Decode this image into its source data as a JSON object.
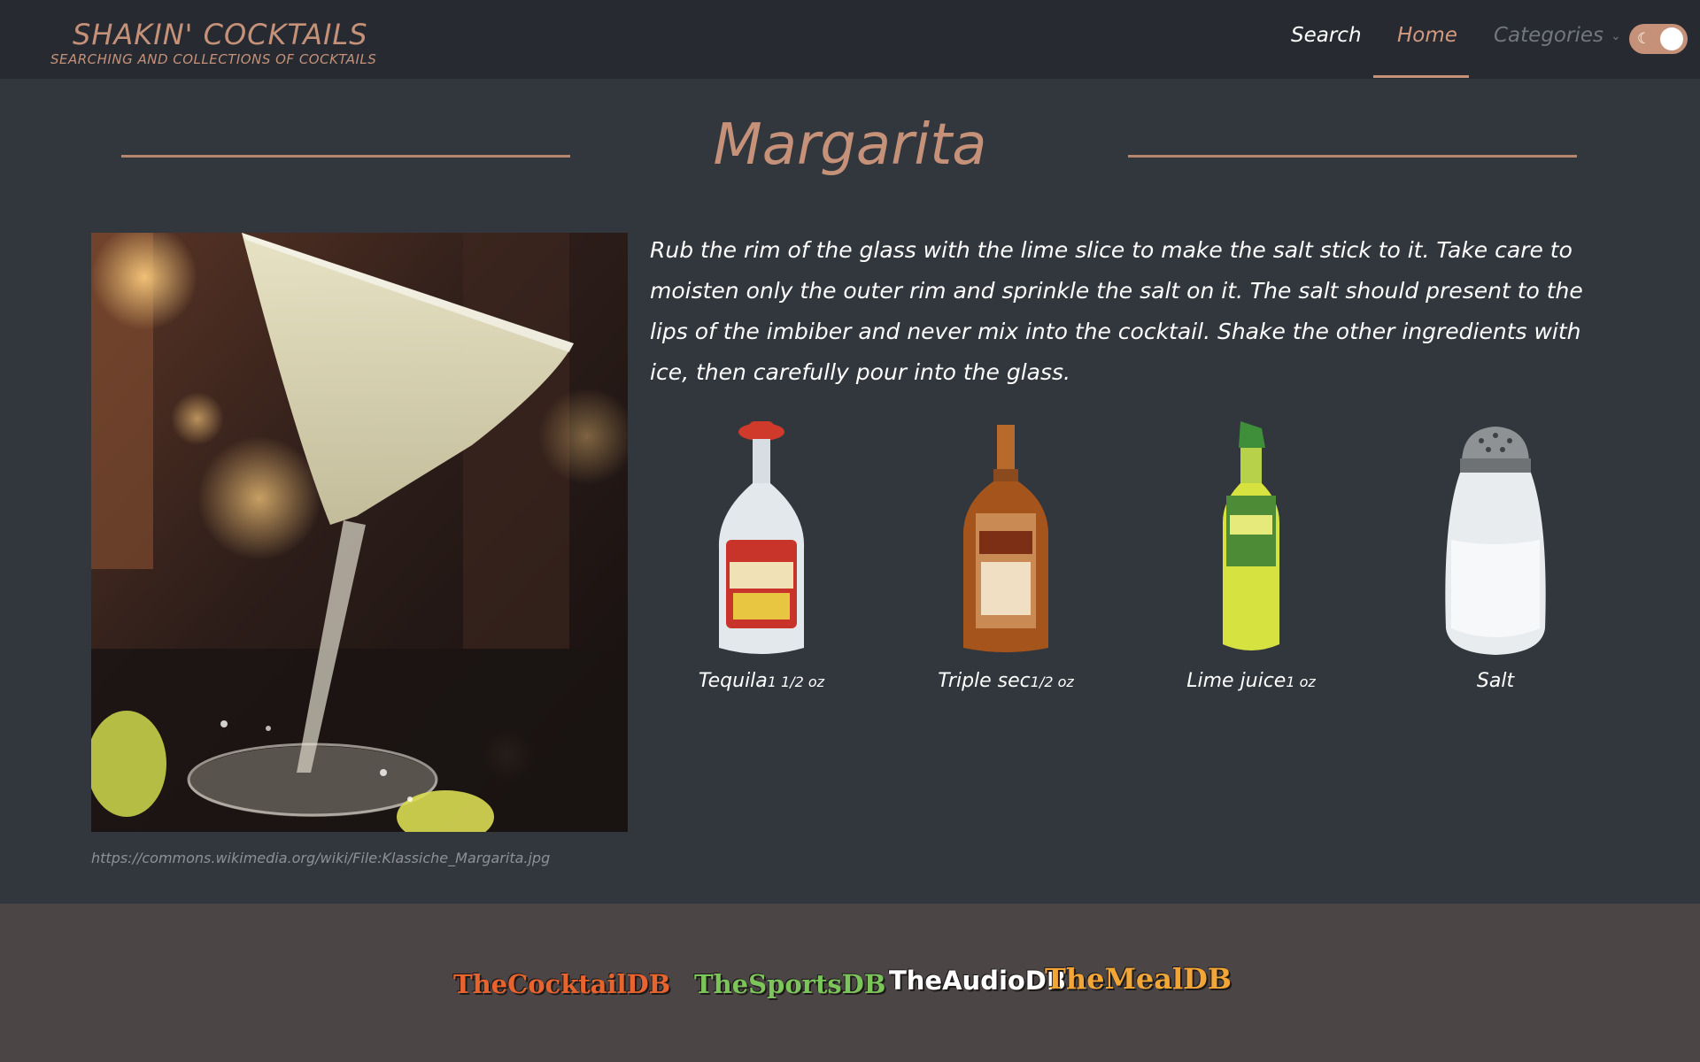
{
  "header": {
    "brand_title": "SHAKIN' COCKTAILS",
    "brand_subtitle": "SEARCHING AND COLLECTIONS OF COCKTAILS",
    "nav": {
      "search": "Search",
      "home": "Home",
      "categories": "Categories"
    },
    "active_nav": "Home",
    "dark_mode_toggle": "on"
  },
  "drink": {
    "name": "Margarita",
    "image_credit": "https://commons.wikimedia.org/wiki/File:Klassiche_Margarita.jpg",
    "instructions": "Rub the rim of the glass with the lime slice to make the salt stick to it. Take care to moisten only the outer rim and sprinkle the salt on it. The salt should present to the lips of the imbiber and never mix into the cocktail. Shake the other ingredients with ice, then carefully pour into the glass.",
    "ingredients": [
      {
        "name": "Tequila",
        "measure": "1 1/2 oz"
      },
      {
        "name": "Triple sec",
        "measure": "1/2 oz"
      },
      {
        "name": "Lime juice",
        "measure": "1 oz"
      },
      {
        "name": "Salt",
        "measure": ""
      }
    ]
  },
  "footer": {
    "logos": [
      "TheCocktailDB",
      "TheSportsDB",
      "TheAudioDB",
      "TheMealDB"
    ]
  },
  "colors": {
    "accent": "#c59279",
    "header_bg": "#272a31",
    "page_bg": "#32363d",
    "footer_bg": "#4b4545"
  }
}
